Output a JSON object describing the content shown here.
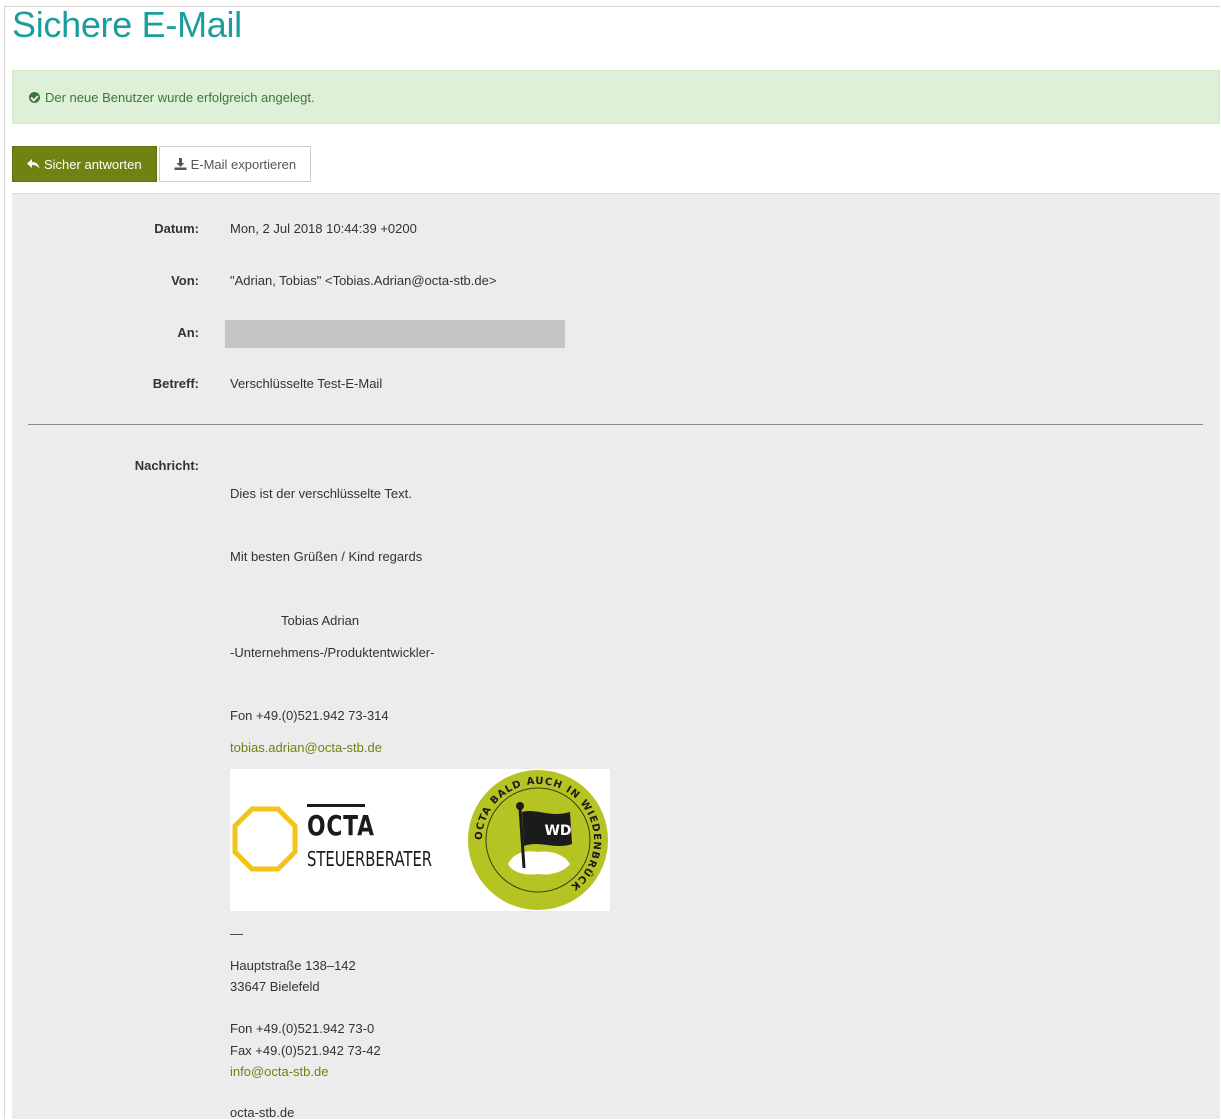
{
  "page": {
    "title": "Sichere E-Mail"
  },
  "alert": {
    "message": "Der neue Benutzer wurde erfolgreich angelegt.",
    "color": "#3c763d",
    "background": "#dff0d8"
  },
  "toolbar": {
    "reply_label": "Sicher antworten",
    "reply_icon": "reply-icon",
    "export_label": "E-Mail exportieren",
    "export_icon": "download-icon",
    "accent": "#6e8312"
  },
  "email": {
    "date_label": "Datum:",
    "date_value": "Mon, 2 Jul 2018 10:44:39 +0200",
    "from_label": "Von:",
    "from_value": "\"Adrian, Tobias\" <Tobias.Adrian@octa-stb.de>",
    "to_label": "An:",
    "subject_label": "Betreff:",
    "subject_value": "Verschlüsselte Test-E-Mail",
    "message_label": "Nachricht:"
  },
  "message": {
    "line1": "Dies ist der verschlüsselte Text.",
    "greeting": "Mit besten Grüßen / Kind regards",
    "name": "Tobias Adrian",
    "role": "-Unternehmens-/Produktentwickler-",
    "phone": "Fon +49.(0)521.942 73-314",
    "email_link": "tobias.adrian@octa-stb.de",
    "dash": "—",
    "street": "Hauptstraße 138–142",
    "city": "33647 Bielefeld",
    "office_phone": "Fon +49.(0)521.942 73-0",
    "office_fax": "Fax +49.(0)521.942 73-42",
    "office_email": "info@octa-stb.de",
    "website": "octa-stb.de"
  },
  "logo": {
    "company": "OCTA",
    "subtitle": "STEUERBERATER",
    "badge_text": "OCTA BALD AUCH IN WIEDENBRÜCK",
    "badge_flag": "WD",
    "badge_color": "#b5c422"
  }
}
